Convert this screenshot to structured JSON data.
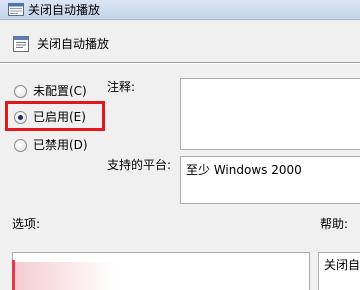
{
  "window": {
    "title": "关闭自动播放"
  },
  "header": {
    "title": "关闭自动播放"
  },
  "state": {
    "options": [
      {
        "label": "未配置(C)",
        "selected": false
      },
      {
        "label": "已启用(E)",
        "selected": true
      },
      {
        "label": "已禁用(D)",
        "selected": false
      }
    ]
  },
  "comment": {
    "label": "注释:",
    "value": ""
  },
  "platform": {
    "label": "支持的平台:",
    "value": "至少 Windows 2000"
  },
  "options_section": {
    "label": "选项:"
  },
  "help_section": {
    "label": "帮助:",
    "text": "关闭自"
  },
  "colors": {
    "highlight": "#e0171d",
    "border": "#adadad"
  }
}
